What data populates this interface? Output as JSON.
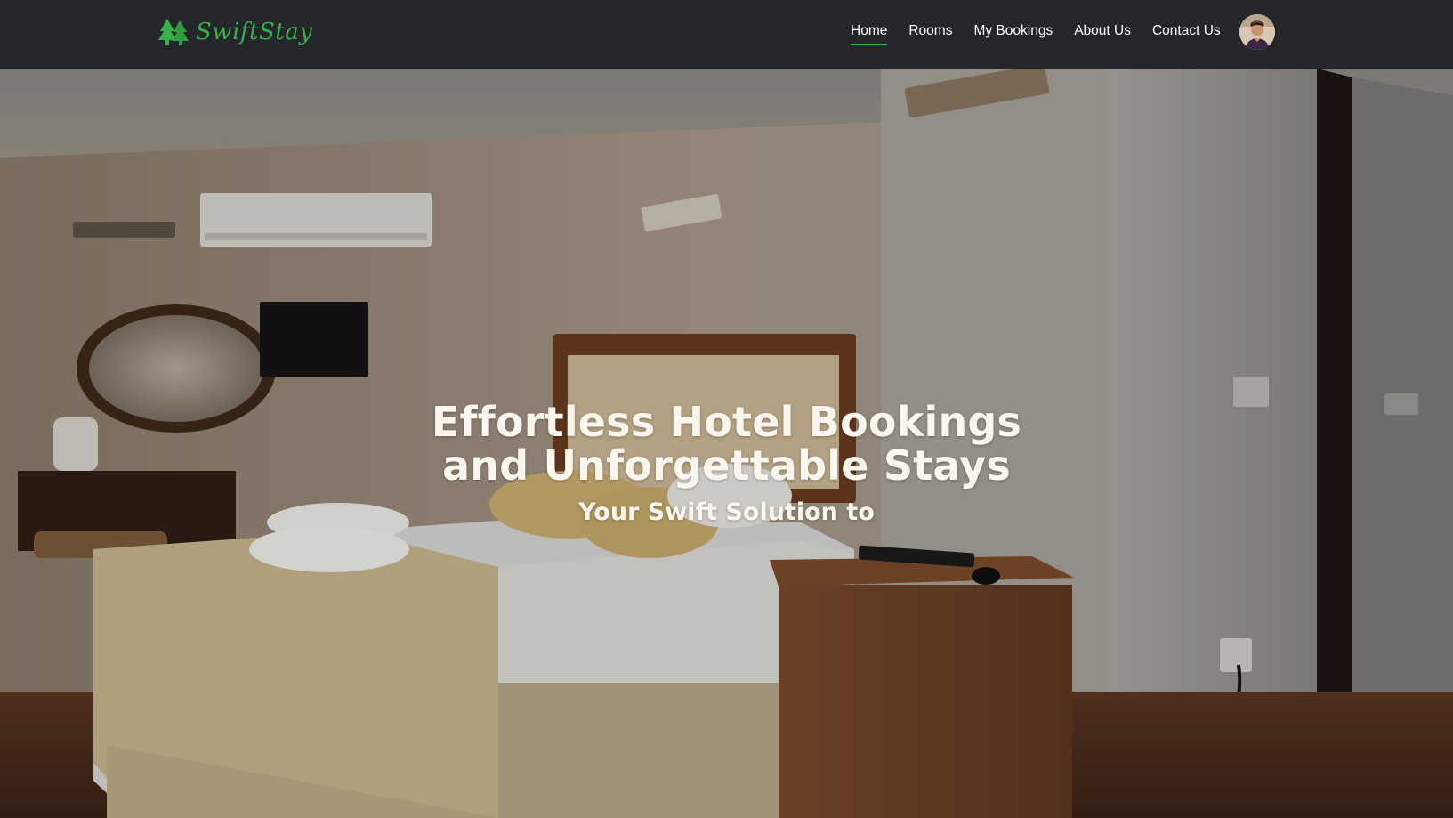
{
  "brand": {
    "name": "SwiftStay",
    "color": "#36b24a"
  },
  "nav": {
    "items": [
      {
        "label": "Home",
        "active": true
      },
      {
        "label": "Rooms",
        "active": false
      },
      {
        "label": "My Bookings",
        "active": false
      },
      {
        "label": "About Us",
        "active": false
      },
      {
        "label": "Contact Us",
        "active": false
      }
    ],
    "avatar_icon": "user-avatar"
  },
  "hero": {
    "title": "Effortless Hotel Bookings and Unforgettable Stays",
    "subtitle": "Your Swift Solution to",
    "background_icon": "hotel-room-photo"
  },
  "colors": {
    "navbar_bg": "#25262b",
    "hero_text": "#fbf6ee",
    "active_underline": "#36b24a"
  }
}
